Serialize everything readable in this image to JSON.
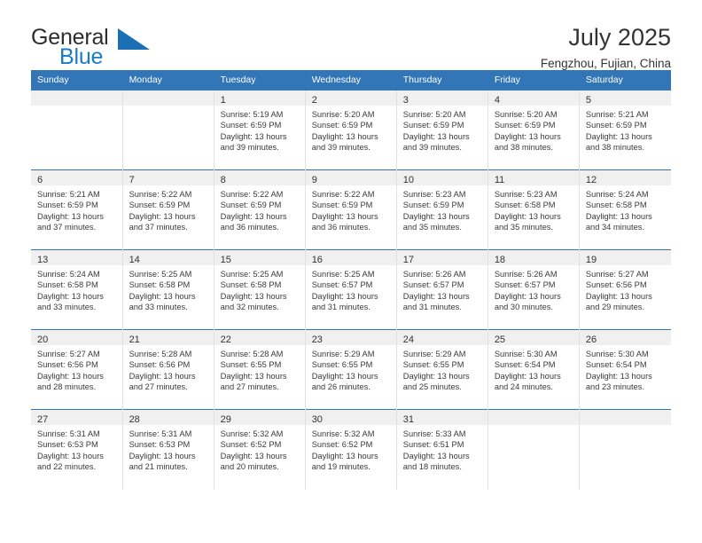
{
  "brand": {
    "name_top": "General",
    "name_bottom": "Blue",
    "accent_color": "#1a7bc4",
    "logo_icon": "blue-triangle-icon"
  },
  "header": {
    "title": "July 2025",
    "subtitle": "Fengzhou, Fujian, China"
  },
  "calendar": {
    "header_color": "#3276b8",
    "daynum_band_color": "#f0f0f0",
    "weekday_headers": [
      "Sunday",
      "Monday",
      "Tuesday",
      "Wednesday",
      "Thursday",
      "Friday",
      "Saturday"
    ],
    "weeks": [
      [
        {
          "day": ""
        },
        {
          "day": ""
        },
        {
          "day": "1",
          "sunrise": "Sunrise: 5:19 AM",
          "sunset": "Sunset: 6:59 PM",
          "daylight_1": "Daylight: 13 hours",
          "daylight_2": "and 39 minutes."
        },
        {
          "day": "2",
          "sunrise": "Sunrise: 5:20 AM",
          "sunset": "Sunset: 6:59 PM",
          "daylight_1": "Daylight: 13 hours",
          "daylight_2": "and 39 minutes."
        },
        {
          "day": "3",
          "sunrise": "Sunrise: 5:20 AM",
          "sunset": "Sunset: 6:59 PM",
          "daylight_1": "Daylight: 13 hours",
          "daylight_2": "and 39 minutes."
        },
        {
          "day": "4",
          "sunrise": "Sunrise: 5:20 AM",
          "sunset": "Sunset: 6:59 PM",
          "daylight_1": "Daylight: 13 hours",
          "daylight_2": "and 38 minutes."
        },
        {
          "day": "5",
          "sunrise": "Sunrise: 5:21 AM",
          "sunset": "Sunset: 6:59 PM",
          "daylight_1": "Daylight: 13 hours",
          "daylight_2": "and 38 minutes."
        }
      ],
      [
        {
          "day": "6",
          "sunrise": "Sunrise: 5:21 AM",
          "sunset": "Sunset: 6:59 PM",
          "daylight_1": "Daylight: 13 hours",
          "daylight_2": "and 37 minutes."
        },
        {
          "day": "7",
          "sunrise": "Sunrise: 5:22 AM",
          "sunset": "Sunset: 6:59 PM",
          "daylight_1": "Daylight: 13 hours",
          "daylight_2": "and 37 minutes."
        },
        {
          "day": "8",
          "sunrise": "Sunrise: 5:22 AM",
          "sunset": "Sunset: 6:59 PM",
          "daylight_1": "Daylight: 13 hours",
          "daylight_2": "and 36 minutes."
        },
        {
          "day": "9",
          "sunrise": "Sunrise: 5:22 AM",
          "sunset": "Sunset: 6:59 PM",
          "daylight_1": "Daylight: 13 hours",
          "daylight_2": "and 36 minutes."
        },
        {
          "day": "10",
          "sunrise": "Sunrise: 5:23 AM",
          "sunset": "Sunset: 6:59 PM",
          "daylight_1": "Daylight: 13 hours",
          "daylight_2": "and 35 minutes."
        },
        {
          "day": "11",
          "sunrise": "Sunrise: 5:23 AM",
          "sunset": "Sunset: 6:58 PM",
          "daylight_1": "Daylight: 13 hours",
          "daylight_2": "and 35 minutes."
        },
        {
          "day": "12",
          "sunrise": "Sunrise: 5:24 AM",
          "sunset": "Sunset: 6:58 PM",
          "daylight_1": "Daylight: 13 hours",
          "daylight_2": "and 34 minutes."
        }
      ],
      [
        {
          "day": "13",
          "sunrise": "Sunrise: 5:24 AM",
          "sunset": "Sunset: 6:58 PM",
          "daylight_1": "Daylight: 13 hours",
          "daylight_2": "and 33 minutes."
        },
        {
          "day": "14",
          "sunrise": "Sunrise: 5:25 AM",
          "sunset": "Sunset: 6:58 PM",
          "daylight_1": "Daylight: 13 hours",
          "daylight_2": "and 33 minutes."
        },
        {
          "day": "15",
          "sunrise": "Sunrise: 5:25 AM",
          "sunset": "Sunset: 6:58 PM",
          "daylight_1": "Daylight: 13 hours",
          "daylight_2": "and 32 minutes."
        },
        {
          "day": "16",
          "sunrise": "Sunrise: 5:25 AM",
          "sunset": "Sunset: 6:57 PM",
          "daylight_1": "Daylight: 13 hours",
          "daylight_2": "and 31 minutes."
        },
        {
          "day": "17",
          "sunrise": "Sunrise: 5:26 AM",
          "sunset": "Sunset: 6:57 PM",
          "daylight_1": "Daylight: 13 hours",
          "daylight_2": "and 31 minutes."
        },
        {
          "day": "18",
          "sunrise": "Sunrise: 5:26 AM",
          "sunset": "Sunset: 6:57 PM",
          "daylight_1": "Daylight: 13 hours",
          "daylight_2": "and 30 minutes."
        },
        {
          "day": "19",
          "sunrise": "Sunrise: 5:27 AM",
          "sunset": "Sunset: 6:56 PM",
          "daylight_1": "Daylight: 13 hours",
          "daylight_2": "and 29 minutes."
        }
      ],
      [
        {
          "day": "20",
          "sunrise": "Sunrise: 5:27 AM",
          "sunset": "Sunset: 6:56 PM",
          "daylight_1": "Daylight: 13 hours",
          "daylight_2": "and 28 minutes."
        },
        {
          "day": "21",
          "sunrise": "Sunrise: 5:28 AM",
          "sunset": "Sunset: 6:56 PM",
          "daylight_1": "Daylight: 13 hours",
          "daylight_2": "and 27 minutes."
        },
        {
          "day": "22",
          "sunrise": "Sunrise: 5:28 AM",
          "sunset": "Sunset: 6:55 PM",
          "daylight_1": "Daylight: 13 hours",
          "daylight_2": "and 27 minutes."
        },
        {
          "day": "23",
          "sunrise": "Sunrise: 5:29 AM",
          "sunset": "Sunset: 6:55 PM",
          "daylight_1": "Daylight: 13 hours",
          "daylight_2": "and 26 minutes."
        },
        {
          "day": "24",
          "sunrise": "Sunrise: 5:29 AM",
          "sunset": "Sunset: 6:55 PM",
          "daylight_1": "Daylight: 13 hours",
          "daylight_2": "and 25 minutes."
        },
        {
          "day": "25",
          "sunrise": "Sunrise: 5:30 AM",
          "sunset": "Sunset: 6:54 PM",
          "daylight_1": "Daylight: 13 hours",
          "daylight_2": "and 24 minutes."
        },
        {
          "day": "26",
          "sunrise": "Sunrise: 5:30 AM",
          "sunset": "Sunset: 6:54 PM",
          "daylight_1": "Daylight: 13 hours",
          "daylight_2": "and 23 minutes."
        }
      ],
      [
        {
          "day": "27",
          "sunrise": "Sunrise: 5:31 AM",
          "sunset": "Sunset: 6:53 PM",
          "daylight_1": "Daylight: 13 hours",
          "daylight_2": "and 22 minutes."
        },
        {
          "day": "28",
          "sunrise": "Sunrise: 5:31 AM",
          "sunset": "Sunset: 6:53 PM",
          "daylight_1": "Daylight: 13 hours",
          "daylight_2": "and 21 minutes."
        },
        {
          "day": "29",
          "sunrise": "Sunrise: 5:32 AM",
          "sunset": "Sunset: 6:52 PM",
          "daylight_1": "Daylight: 13 hours",
          "daylight_2": "and 20 minutes."
        },
        {
          "day": "30",
          "sunrise": "Sunrise: 5:32 AM",
          "sunset": "Sunset: 6:52 PM",
          "daylight_1": "Daylight: 13 hours",
          "daylight_2": "and 19 minutes."
        },
        {
          "day": "31",
          "sunrise": "Sunrise: 5:33 AM",
          "sunset": "Sunset: 6:51 PM",
          "daylight_1": "Daylight: 13 hours",
          "daylight_2": "and 18 minutes."
        },
        {
          "day": ""
        },
        {
          "day": ""
        }
      ]
    ]
  }
}
